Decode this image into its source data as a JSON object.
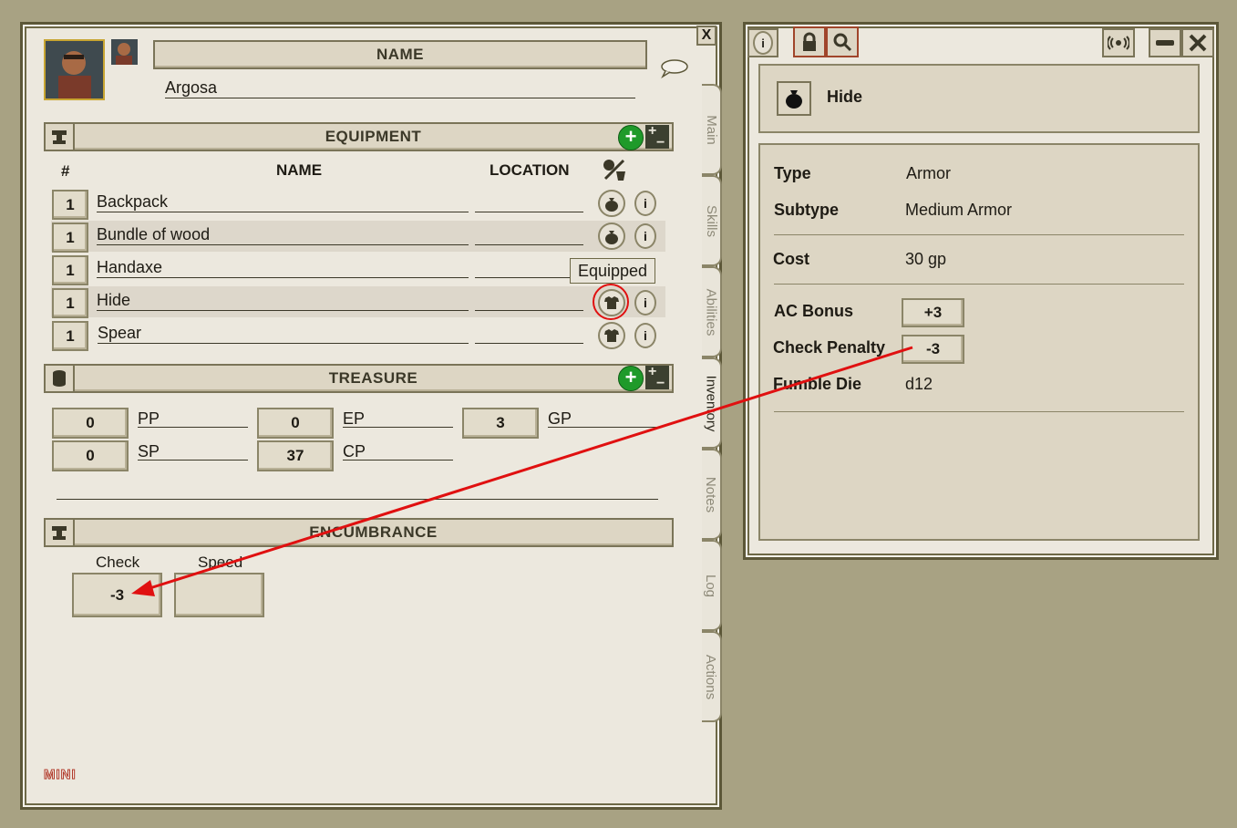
{
  "charsheet": {
    "close_glyph": "X",
    "name_header": "NAME",
    "name_value": "Argosa",
    "equipment": {
      "title": "EQUIPMENT",
      "col_num": "#",
      "col_name": "NAME",
      "col_location": "LOCATION",
      "items": [
        {
          "qty": "1",
          "name": "Backpack",
          "icon": "bag-icon"
        },
        {
          "qty": "1",
          "name": "Bundle of wood",
          "icon": "bag-icon"
        },
        {
          "qty": "1",
          "name": "Handaxe",
          "icon": "shirt-icon"
        },
        {
          "qty": "1",
          "name": "Hide",
          "icon": "shirt-icon"
        },
        {
          "qty": "1",
          "name": "Spear",
          "icon": "shirt-icon"
        }
      ],
      "tooltip": "Equipped"
    },
    "treasure": {
      "title": "TREASURE",
      "coins": [
        {
          "value": "0",
          "label": "PP"
        },
        {
          "value": "0",
          "label": "EP"
        },
        {
          "value": "3",
          "label": "GP"
        },
        {
          "value": "0",
          "label": "SP"
        },
        {
          "value": "37",
          "label": "CP"
        }
      ]
    },
    "encumbrance": {
      "title": "ENCUMBRANCE",
      "check_label": "Check",
      "check_value": "-3",
      "speed_label": "Speed",
      "speed_value": ""
    },
    "tabs": [
      "Main",
      "Skills",
      "Abilities",
      "Inventory",
      "Notes",
      "Log",
      "Actions"
    ],
    "active_tab": "Inventory",
    "logo": "MINI"
  },
  "item_window": {
    "title": "Hide",
    "fields": {
      "type_label": "Type",
      "type_value": "Armor",
      "subtype_label": "Subtype",
      "subtype_value": "Medium Armor",
      "cost_label": "Cost",
      "cost_value": "30 gp",
      "ac_label": "AC Bonus",
      "ac_value": "+3",
      "check_label": "Check Penalty",
      "check_value": "-3",
      "fumble_label": "Fumble Die",
      "fumble_value": "d12"
    }
  },
  "colors": {
    "background": "#a8a283",
    "panel": "#ece8de",
    "header": "#ddd6c4",
    "border": "#5c5738",
    "annotation": "#e01010",
    "add_button": "#1f9a2a"
  }
}
